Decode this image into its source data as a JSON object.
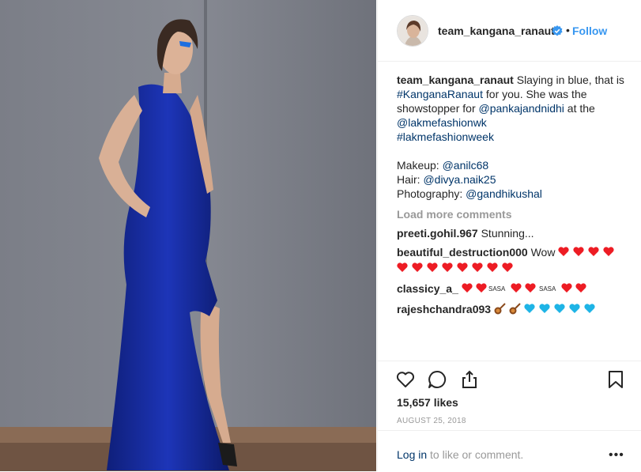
{
  "header": {
    "username": "team_kangana_ranaut",
    "verified": true,
    "separator": "•",
    "follow_label": "Follow"
  },
  "caption": {
    "username": "team_kangana_ranaut",
    "line1": "Slaying in blue, that is",
    "tag1": "#KanganaRanaut",
    "t2": " for you. She was the showstopper for ",
    "mention1": "@pankajandnidhi",
    "t3": " at the ",
    "mention2": "@lakmefashionwk",
    "tag2": "#lakmefashionweek",
    "makeup_label": "Makeup: ",
    "makeup_handle": "@anilc68",
    "hair_label": "Hair: ",
    "hair_handle": "@divya.naik25",
    "photo_label": "Photography: ",
    "photo_handle": "@gandhikushal"
  },
  "load_more": "Load more comments",
  "comments": [
    {
      "user": "preeti.gohil.967",
      "text": "Stunning..."
    },
    {
      "user": "beautiful_destruction000",
      "text": "Wow",
      "emoji": "red-hearts-x12"
    },
    {
      "user": "classicy_a_",
      "text": "",
      "emoji": "heart-sasa-sequence",
      "sasa": "SASA"
    },
    {
      "user": "rajeshchandra093",
      "text": "",
      "emoji": "guitars-and-blue-hearts"
    }
  ],
  "likes": "15,657 likes",
  "date": "AUGUST 25, 2018",
  "footer": {
    "login_link": "Log in",
    "login_text": " to like or comment.",
    "more": "•••"
  },
  "colors": {
    "accent": "#3897f0",
    "link": "#003569",
    "heart": "#ed1c24",
    "blue_heart": "#1eb4e6",
    "dress": "#1a2fa8"
  }
}
